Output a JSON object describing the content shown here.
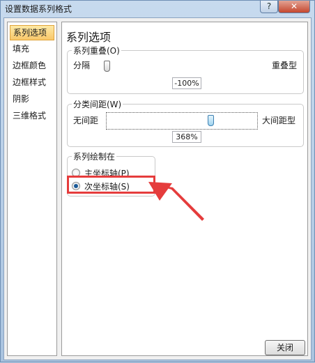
{
  "window": {
    "title": "设置数据系列格式",
    "help_glyph": "?",
    "close_glyph": "✕"
  },
  "sidebar": {
    "items": [
      {
        "label": "系列选项",
        "selected": true
      },
      {
        "label": "填充"
      },
      {
        "label": "边框颜色"
      },
      {
        "label": "边框样式"
      },
      {
        "label": "阴影"
      },
      {
        "label": "三维格式"
      }
    ]
  },
  "panel": {
    "title": "系列选项",
    "overlap": {
      "group_title": "系列重叠(O)",
      "left_label": "分隔",
      "right_label": "重叠型",
      "value": "-100%"
    },
    "gap": {
      "group_title": "分类间距(W)",
      "left_label": "无间距",
      "right_label": "大间距型",
      "value": "368%"
    },
    "plot_on": {
      "group_title": "系列绘制在",
      "options": [
        {
          "label": "主坐标轴(P)",
          "checked": false
        },
        {
          "label": "次坐标轴(S)",
          "checked": true
        }
      ]
    }
  },
  "footer": {
    "close_label": "关闭"
  },
  "colors": {
    "annotation": "#e53c3c",
    "selected_bg": "#f8c76a",
    "titlebar": "#b8cfe6"
  }
}
